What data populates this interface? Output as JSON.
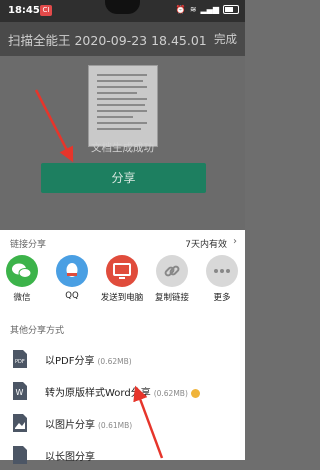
{
  "status_bar": {
    "time": "18:45",
    "notif_badge": "CI"
  },
  "top_bar": {
    "title": "扫描全能王 2020-09-23 18.45.01",
    "done_label": "完成"
  },
  "document": {
    "status_text": "文档生成成功",
    "share_button_label": "分享"
  },
  "share_sheet": {
    "link_section_title": "链接分享",
    "link_validity": "7天内有效",
    "apps": [
      {
        "label": "微信",
        "icon": "wechat-icon"
      },
      {
        "label": "QQ",
        "icon": "qq-icon"
      },
      {
        "label": "发送到电脑",
        "icon": "computer-icon"
      },
      {
        "label": "复制链接",
        "icon": "link-icon"
      },
      {
        "label": "更多",
        "icon": "more-icon"
      }
    ],
    "other_section_title": "其他分享方式",
    "options": [
      {
        "label": "以PDF分享",
        "size": "(0.62MB)",
        "icon": "pdf-icon"
      },
      {
        "label": "转为原版样式Word分享",
        "size": "(0.62MB)",
        "icon": "word-icon"
      },
      {
        "label": "以图片分享",
        "size": "(0.61MB)",
        "icon": "image-icon"
      },
      {
        "label": "以长图分享",
        "size": "",
        "icon": "long-image-icon"
      }
    ]
  },
  "colors": {
    "accent_green": "#1d7f60",
    "wechat": "#3cb34a",
    "qq": "#4a9fe3",
    "pc": "#e04c3c",
    "arrow": "#e6352b"
  }
}
